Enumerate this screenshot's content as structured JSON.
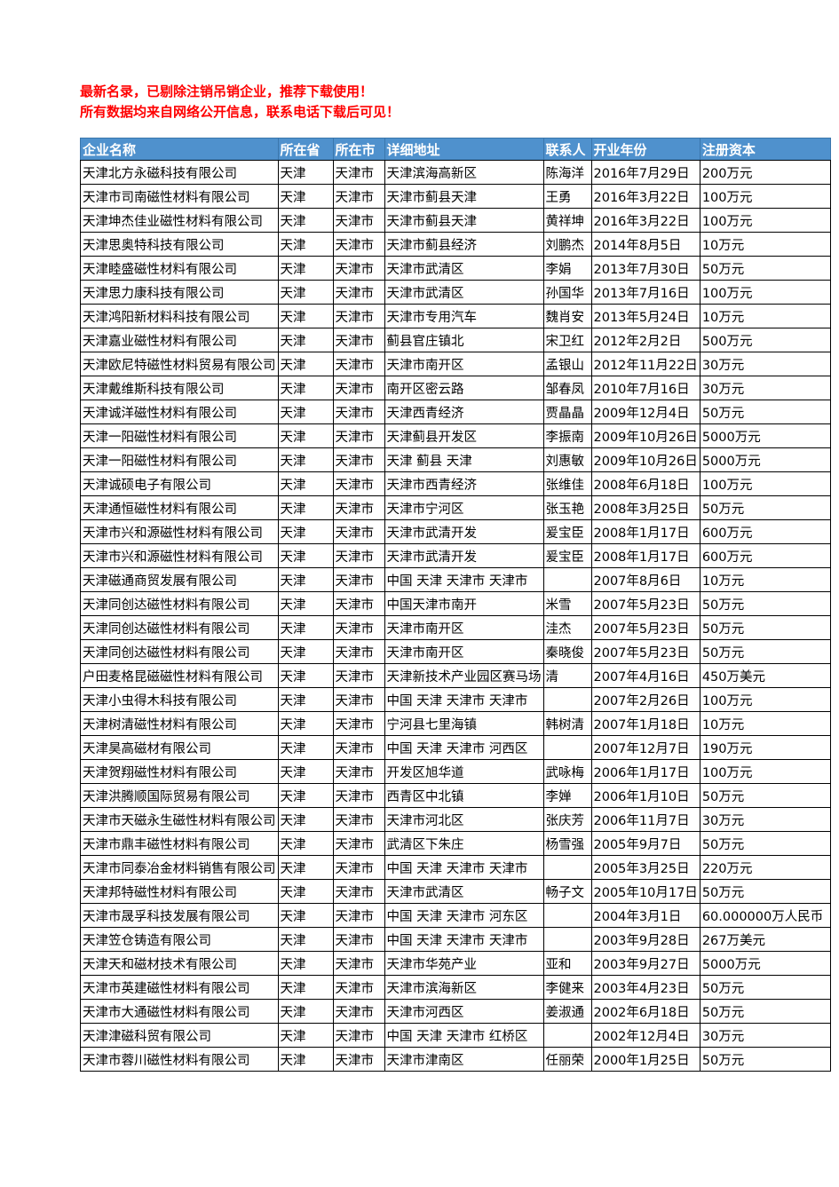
{
  "notice": {
    "line1": "最新名录，已剔除注销吊销企业，推荐下载使用！",
    "line2": "所有数据均来自网络公开信息，联系电话下载后可见！",
    "color": "#FF0000"
  },
  "table": {
    "header_bg": "#4F91CD",
    "header_color": "#FFFFFF",
    "columns": [
      "企业名称",
      "所在省",
      "所在市",
      "详细地址",
      "联系人",
      "开业年份",
      "注册资本"
    ],
    "rows": [
      [
        "天津北方永磁科技有限公司",
        "天津",
        "天津市",
        "天津滨海高新区",
        "陈海洋",
        "2016年7月29日",
        "200万元"
      ],
      [
        "天津市司南磁性材料有限公司",
        "天津",
        "天津市",
        "天津市蓟县天津",
        "王勇",
        "2016年3月22日",
        "100万元"
      ],
      [
        "天津坤杰佳业磁性材料有限公司",
        "天津",
        "天津市",
        "天津市蓟县天津",
        "黄祥坤",
        "2016年3月22日",
        "100万元"
      ],
      [
        "天津思奥特科技有限公司",
        "天津",
        "天津市",
        "天津市蓟县经济",
        "刘鹏杰",
        "2014年8月5日",
        "10万元"
      ],
      [
        "天津睦盛磁性材料有限公司",
        "天津",
        "天津市",
        "天津市武清区",
        "李娟",
        "2013年7月30日",
        "50万元"
      ],
      [
        "天津思力康科技有限公司",
        "天津",
        "天津市",
        "天津市武清区",
        "孙国华",
        "2013年7月16日",
        "100万元"
      ],
      [
        "天津鸿阳新材料科技有限公司",
        "天津",
        "天津市",
        "天津市专用汽车",
        "魏肖安",
        "2013年5月24日",
        "10万元"
      ],
      [
        "天津嘉业磁性材料有限公司",
        "天津",
        "天津市",
        "蓟县官庄镇北",
        "宋卫红",
        "2012年2月2日",
        "500万元"
      ],
      [
        "天津欧尼特磁性材料贸易有限公司",
        "天津",
        "天津市",
        "天津市南开区",
        "孟银山",
        "2012年11月22日",
        "30万元"
      ],
      [
        "天津戴维斯科技有限公司",
        "天津",
        "天津市",
        "南开区密云路",
        "邹春凤",
        "2010年7月16日",
        "30万元"
      ],
      [
        "天津诚洋磁性材料有限公司",
        "天津",
        "天津市",
        "天津西青经济",
        "贾晶晶",
        "2009年12月4日",
        "50万元"
      ],
      [
        "天津一阳磁性材料有限公司",
        "天津",
        "天津市",
        "天津蓟县开发区",
        "李振南",
        "2009年10月26日",
        "5000万元"
      ],
      [
        "天津一阳磁性材料有限公司",
        "天津",
        "天津市",
        "天津 蓟县 天津",
        "刘惠敏",
        "2009年10月26日",
        "5000万元"
      ],
      [
        "天津诚硕电子有限公司",
        "天津",
        "天津市",
        "天津市西青经济",
        "张维佳",
        "2008年6月18日",
        "100万元"
      ],
      [
        "天津通恒磁性材料有限公司",
        "天津",
        "天津市",
        "天津市宁河区",
        "张玉艳",
        "2008年3月25日",
        "50万元"
      ],
      [
        "天津市兴和源磁性材料有限公司",
        "天津",
        "天津市",
        "天津市武清开发",
        "爰宝臣",
        "2008年1月17日",
        "600万元"
      ],
      [
        "天津市兴和源磁性材料有限公司",
        "天津",
        "天津市",
        "天津市武清开发",
        "爰宝臣",
        "2008年1月17日",
        "600万元"
      ],
      [
        "天津磁通商贸发展有限公司",
        "天津",
        "天津市",
        "中国 天津 天津市 天津市",
        "",
        "2007年8月6日",
        "10万元"
      ],
      [
        "天津同创达磁性材料有限公司",
        "天津",
        "天津市",
        "中国天津市南开",
        "米雪",
        "2007年5月23日",
        "50万元"
      ],
      [
        "天津同创达磁性材料有限公司",
        "天津",
        "天津市",
        "天津市南开区",
        "洼杰",
        "2007年5月23日",
        "50万元"
      ],
      [
        "天津同创达磁性材料有限公司",
        "天津",
        "天津市",
        "天津市南开区",
        "秦晓俊",
        "2007年5月23日",
        "50万元"
      ],
      [
        "户田麦格昆磁磁性材料有限公司",
        "天津",
        "天津市",
        "天津新技术产业园区赛马场",
        "清",
        "2007年4月16日",
        "450万美元"
      ],
      [
        "天津小虫得木科技有限公司",
        "天津",
        "天津市",
        "中国 天津 天津市 天津市",
        "",
        "2007年2月26日",
        "100万元"
      ],
      [
        "天津树清磁性材料有限公司",
        "天津",
        "天津市",
        "宁河县七里海镇",
        "韩树清",
        "2007年1月18日",
        "10万元"
      ],
      [
        "天津昊高磁材有限公司",
        "天津",
        "天津市",
        "中国 天津 天津市 河西区",
        "",
        "2007年12月7日",
        "190万元"
      ],
      [
        "天津贺翔磁性材料有限公司",
        "天津",
        "天津市",
        "开发区旭华道",
        "武咏梅",
        "2006年1月17日",
        "100万元"
      ],
      [
        "天津洪腾顺国际贸易有限公司",
        "天津",
        "天津市",
        "西青区中北镇",
        "李婵",
        "2006年1月10日",
        "50万元"
      ],
      [
        "天津市天磁永生磁性材料有限公司",
        "天津",
        "天津市",
        "天津市河北区",
        "张庆芳",
        "2006年11月7日",
        "30万元"
      ],
      [
        "天津市鼎丰磁性材料有限公司",
        "天津",
        "天津市",
        "武清区下朱庄",
        "杨雪强",
        "2005年9月7日",
        "50万元"
      ],
      [
        "天津市同泰冶金材料销售有限公司",
        "天津",
        "天津市",
        "中国 天津 天津市 天津市",
        "",
        "2005年3月25日",
        "220万元"
      ],
      [
        "天津邦特磁性材料有限公司",
        "天津",
        "天津市",
        "天津市武清区",
        "畅子文",
        "2005年10月17日",
        "50万元"
      ],
      [
        "天津市晟孚科技发展有限公司",
        "天津",
        "天津市",
        "中国 天津 天津市 河东区",
        "",
        "2004年3月1日",
        "60.000000万人民币"
      ],
      [
        "天津笠仓铸造有限公司",
        "天津",
        "天津市",
        "中国 天津 天津市 天津市",
        "",
        "2003年9月28日",
        "267万美元"
      ],
      [
        "天津天和磁材技术有限公司",
        "天津",
        "天津市",
        "天津市华苑产业",
        "亚和",
        "2003年9月27日",
        "5000万元"
      ],
      [
        "天津市英建磁性材料有限公司",
        "天津",
        "天津市",
        "天津市滨海新区",
        "李健来",
        "2003年4月23日",
        "50万元"
      ],
      [
        "天津市大通磁性材料有限公司",
        "天津",
        "天津市",
        "天津市河西区",
        "姜淑通",
        "2002年6月18日",
        "50万元"
      ],
      [
        "天津津磁科贸有限公司",
        "天津",
        "天津市",
        "中国 天津 天津市 红桥区",
        "",
        "2002年12月4日",
        "30万元"
      ],
      [
        "天津市蓉川磁性材料有限公司",
        "天津",
        "天津市",
        "天津市津南区",
        "任丽荣",
        "2000年1月25日",
        "50万元"
      ]
    ]
  }
}
